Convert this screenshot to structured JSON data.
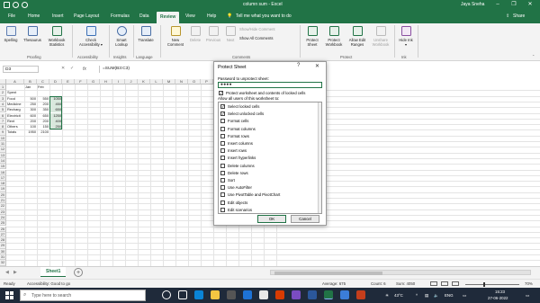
{
  "titlebar": {
    "autosave_label": "",
    "document_title": "column sum - Excel",
    "search_placeholder": "Search",
    "user_name": "Jaya Sneha",
    "minimize": "–",
    "maximize": "❐",
    "close": "✕"
  },
  "tabs": [
    "File",
    "Home",
    "Insert",
    "Page Layout",
    "Formulas",
    "Data",
    "Review",
    "View",
    "Help"
  ],
  "active_tab": "Review",
  "tell_me": "Tell me what you want to do",
  "share": "Share",
  "ribbon": {
    "spelling": "Spelling",
    "thesaurus": "Thesaurus",
    "workbook_statistics": "Workbook Statistics",
    "group_proofing": "Proofing",
    "check_accessibility": "Check Accessibility ▾",
    "group_accessibility": "Accessibility",
    "smart_lookup": "Smart Lookup",
    "group_insights": "Insights",
    "translate": "Translate",
    "group_language": "Language",
    "new_comment": "New Comment",
    "delete": "Delete",
    "previous": "Previous",
    "next": "Next",
    "show_hide_comment": "Show/Hide Comment",
    "show_all_comments": "Show All Comments",
    "group_comments": "Comments",
    "protect_sheet": "Protect Sheet",
    "protect_workbook": "Protect Workbook",
    "allow_edit_ranges": "Allow Edit Ranges",
    "unshare_workbook": "Unshare Workbook",
    "group_protect": "Protect",
    "hide_ink": "Hide Ink ▾",
    "group_ink": "Ink"
  },
  "formula_bar": {
    "name_box": "D3",
    "fx": "fx",
    "formula": "=SUM(B3:C3)"
  },
  "sheet": {
    "columns": [
      "A",
      "B",
      "C",
      "D",
      "E",
      "F",
      "G",
      "H",
      "I",
      "J",
      "K",
      "L",
      "M",
      "N",
      "O",
      "P",
      "Q",
      "R",
      "S",
      "T",
      "U"
    ],
    "rows": [
      "1",
      "2",
      "3",
      "4",
      "5",
      "6",
      "7",
      "8",
      "9",
      "10",
      "11",
      "12",
      "13",
      "14",
      "15",
      "16",
      "17",
      "18",
      "19",
      "20",
      "21",
      "22",
      "23",
      "24",
      "25",
      "26",
      "27",
      "28",
      "29",
      "30",
      "31",
      "32"
    ],
    "header_row": [
      "",
      "Jan",
      "Feb",
      ""
    ],
    "data": [
      [
        "Spent",
        "",
        "",
        ""
      ],
      [
        "Food",
        "500",
        "550",
        "1050"
      ],
      [
        "Medicine",
        "250",
        "200",
        "450"
      ],
      [
        "Recharg",
        "300",
        "350",
        "650"
      ],
      [
        "Electricit",
        "600",
        "650",
        "1250"
      ],
      [
        "Rent",
        "200",
        "200",
        "400"
      ],
      [
        "Others",
        "100",
        "150",
        "250"
      ],
      [
        "Totals",
        "1950",
        "2100",
        ""
      ]
    ]
  },
  "sheet_tabs": {
    "active": "Sheet1",
    "add": "+"
  },
  "statusbar": {
    "ready": "Ready",
    "accessibility": "Accessibility: Good to go",
    "average": "Average: 675",
    "count": "Count: 6",
    "sum": "Sum: 4050",
    "zoom": "70%"
  },
  "taskbar": {
    "search_placeholder": "Type here to search",
    "weather": "43°C",
    "lang": "ENG",
    "time": "15:23",
    "date": "27-06-2022"
  },
  "dialog": {
    "title": "Protect Sheet",
    "help": "?",
    "close": "✕",
    "password_label": "Password to unprotect sheet:",
    "password_value": "●●●●",
    "protect_label": "Protect worksheet and contents of locked cells",
    "protect_checked": true,
    "allow_label": "Allow all users of this worksheet to:",
    "permissions": [
      {
        "label": "Select locked cells",
        "checked": true
      },
      {
        "label": "Select unlocked cells",
        "checked": true
      },
      {
        "label": "Format cells",
        "checked": false
      },
      {
        "label": "Format columns",
        "checked": false
      },
      {
        "label": "Format rows",
        "checked": false
      },
      {
        "label": "Insert columns",
        "checked": false
      },
      {
        "label": "Insert rows",
        "checked": false
      },
      {
        "label": "Insert hyperlinks",
        "checked": false
      },
      {
        "label": "Delete columns",
        "checked": false
      },
      {
        "label": "Delete rows",
        "checked": false
      },
      {
        "label": "Sort",
        "checked": false
      },
      {
        "label": "Use AutoFilter",
        "checked": false
      },
      {
        "label": "Use PivotTable and PivotChart",
        "checked": false
      },
      {
        "label": "Edit objects",
        "checked": false
      },
      {
        "label": "Edit scenarios",
        "checked": false
      }
    ],
    "ok": "OK",
    "cancel": "Cancel"
  },
  "colors": {
    "excel_green": "#217346",
    "selection_fill": "#d9e8dd",
    "taskbar": "#1f2a3a"
  }
}
